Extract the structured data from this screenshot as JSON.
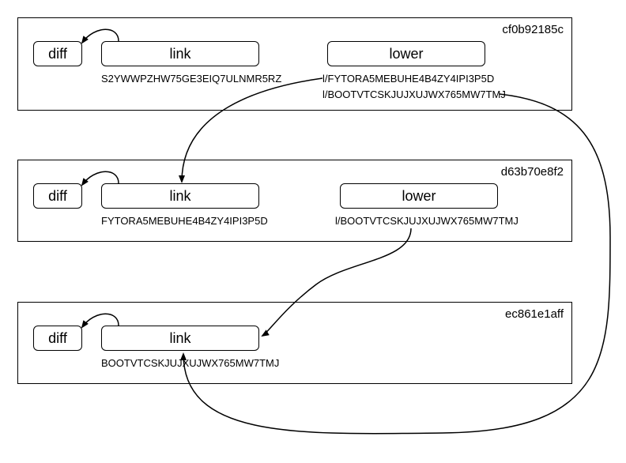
{
  "layers": [
    {
      "id": "cf0b92185c",
      "diff": "diff",
      "link": "link",
      "lower": "lower",
      "linkCaption": "S2YWWPZHW75GE3EIQ7ULNMR5RZ",
      "lowerCaptions": [
        "l/FYTORA5MEBUHE4B4ZY4IPI3P5D",
        "l/BOOTVTCSKJUJXUJWX765MW7TMJ"
      ]
    },
    {
      "id": "d63b70e8f2",
      "diff": "diff",
      "link": "link",
      "lower": "lower",
      "linkCaption": "FYTORA5MEBUHE4B4ZY4IPI3P5D",
      "lowerCaptions": [
        "l/BOOTVTCSKJUJXUJWX765MW7TMJ"
      ]
    },
    {
      "id": "ec861e1aff",
      "diff": "diff",
      "link": "link",
      "lower": null,
      "linkCaption": "BOOTVTCSKJUJXUJWX765MW7TMJ",
      "lowerCaptions": []
    }
  ]
}
